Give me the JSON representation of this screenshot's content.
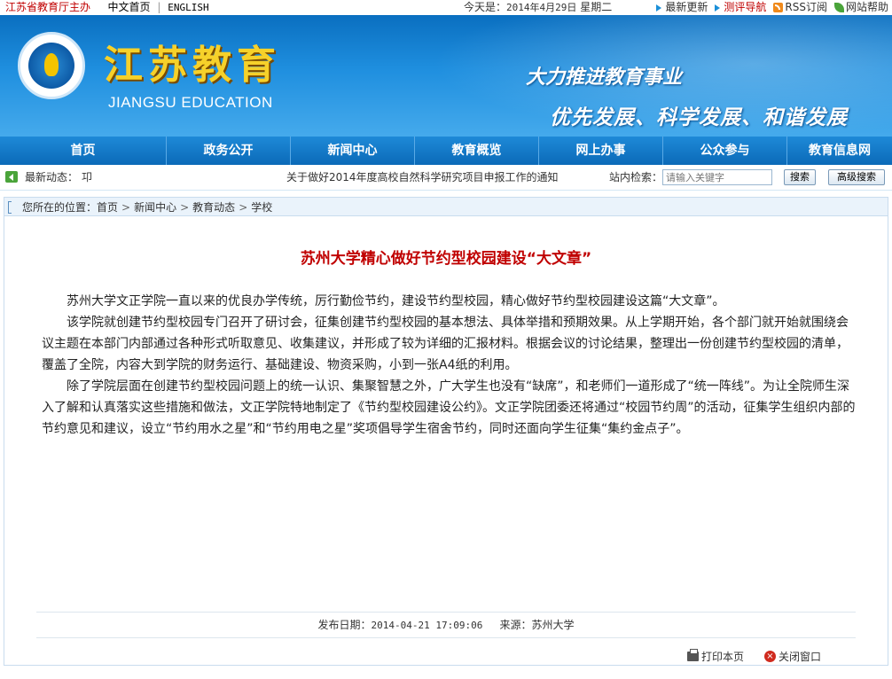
{
  "topbar": {
    "host": "江苏省教育厅主办",
    "links": [
      "中文首页",
      "ENGLISH"
    ],
    "separator": "|",
    "date_prefix": "今天是：",
    "date": "2014年4月29日",
    "weekday": "星期二",
    "right_links": [
      "最新更新",
      "测评导航",
      "RSS订阅",
      "网站帮助"
    ]
  },
  "banner": {
    "logo_title": "江苏教育",
    "logo_subtitle": "JIANGSU EDUCATION",
    "slogan_line1": "大力推进教育事业",
    "slogan_line2": "优先发展、科学发展、和谐发展"
  },
  "nav": {
    "items": [
      "首页",
      "政务公开",
      "新闻中心",
      "教育概览",
      "网上办事",
      "公众参与",
      "教育信息网"
    ]
  },
  "newsbar": {
    "label": "最新动态：",
    "ticker_mark": "卭",
    "headline": "关于做好2014年度高校自然科学研究项目申报工作的通知",
    "search_label": "站内检索：",
    "search_placeholder": "请输入关键字",
    "search_button": "搜索",
    "advanced_button": "高级搜索"
  },
  "breadcrumb": {
    "prefix": "您所在的位置：",
    "items": [
      "首页",
      "新闻中心",
      "教育动态",
      "学校"
    ],
    "arrow": ">"
  },
  "article": {
    "title": "苏州大学精心做好节约型校园建设“大文章”",
    "paragraphs": [
      "苏州大学文正学院一直以来的优良办学传统，厉行勤俭节约，建设节约型校园，精心做好节约型校园建设这篇“大文章”。",
      "该学院就创建节约型校园专门召开了研讨会，征集创建节约型校园的基本想法、具体举措和预期效果。从上学期开始，各个部门就开始就围绕会议主题在本部门内部通过各种形式听取意见、收集建议，并形成了较为详细的汇报材料。根据会议的讨论结果，整理出一份创建节约型校园的清单，覆盖了全院，内容大到学院的财务运行、基础建设、物资采购，小到一张A4纸的利用。",
      "除了学院层面在创建节约型校园问题上的统一认识、集聚智慧之外，广大学生也没有“缺席”，和老师们一道形成了“统一阵线”。为让全院师生深入了解和认真落实这些措施和做法，文正学院特地制定了《节约型校园建设公约》。文正学院团委还将通过“校园节约周”的活动，征集学生组织内部的节约意见和建议，设立“节约用水之星”和“节约用电之星”奖项倡导学生宿舍节约，同时还面向学生征集“集约金点子”。"
    ],
    "publish_label": "发布日期：",
    "publish_date": "2014-04-21 17:09:06",
    "source_label": "来源：",
    "source": "苏州大学"
  },
  "tools": {
    "print": "打印本页",
    "close": "关闭窗口"
  }
}
